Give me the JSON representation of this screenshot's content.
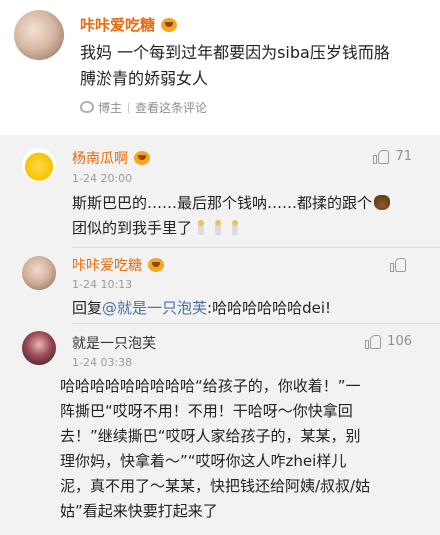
{
  "post": {
    "author": "咔咔爱吃糖",
    "vip_icon": "smiley-face-icon",
    "content_lines": [
      "我妈 一个每到过年都要因为siba压岁钱而胳",
      "膊淤青的娇弱女人"
    ],
    "source": "博主",
    "view_all_label": "查看这条评论"
  },
  "comments": [
    {
      "name": "杨南瓜啊",
      "time": "1-24 20:00",
      "likes": "71",
      "lines": [
        [
          "斯斯巴巴的……最后那个钱呐……都揉的跟个",
          "poop-emoji"
        ],
        [
          "团似的到我手里了",
          "candle-emoji",
          "candle-emoji",
          "candle-emoji"
        ]
      ]
    },
    {
      "name": "咔咔爱吃糖",
      "time": "1-24 10:13",
      "reply_prefix": "回复",
      "mention": "@就是一只泡芙",
      "reply_text": ":哈哈哈哈哈哈dei!"
    },
    {
      "name": "就是一只泡芙",
      "time": "1-24 03:38",
      "likes": "106",
      "lines": [
        "哈哈哈哈哈哈哈哈哈“给孩子的，你收着！”一",
        "阵撕巴“哎呀不用！不用！干哈呀～你快拿回",
        "去！”继续撕巴“哎呀人家给孩子的，某某，别",
        "理你妈，快拿着～”“哎呀你这人咋zhei样儿",
        "泥，真不用了～某某，快把钱还给阿姨/叔叔/姑",
        "姑”看起来快要打起来了"
      ]
    }
  ]
}
